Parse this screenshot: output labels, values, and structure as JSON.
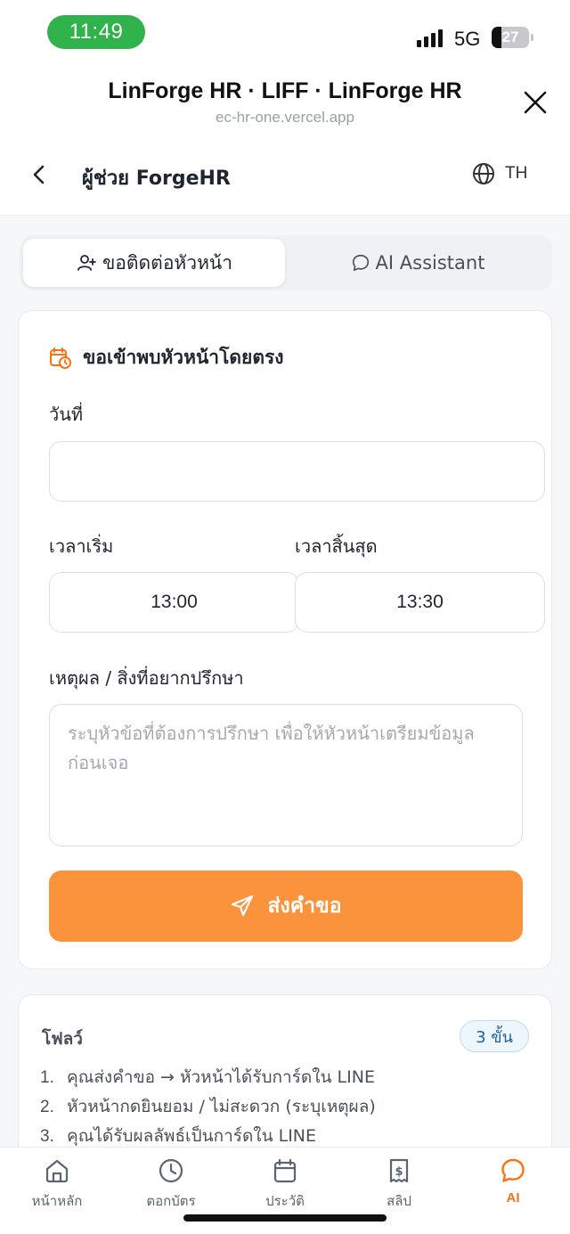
{
  "status_bar": {
    "time": "11:49",
    "network": "5G",
    "battery_percent": "27",
    "battery_level": 0.27,
    "colors": {
      "time_pill": "#2fb34a"
    }
  },
  "liff": {
    "title": "LinForge HR · LIFF · LinForge HR",
    "url": "ec-hr-one.vercel.app",
    "close_icon": "close-icon"
  },
  "app_header": {
    "back_icon": "chevron-left-icon",
    "title": "ผู้ช่วย ForgeHR",
    "language_icon": "globe-icon",
    "language": "TH"
  },
  "tabs": [
    {
      "label": "ขอติดต่อหัวหน้า",
      "icon": "user-plus-icon",
      "active": true
    },
    {
      "label": "AI Assistant",
      "icon": "chat-bubble-icon",
      "active": false
    }
  ],
  "form": {
    "section_icon": "calendar-clock-icon",
    "section_title": "ขอเข้าพบหัวหน้าโดยตรง",
    "date_label": "วันที่",
    "date_value": "",
    "start_label": "เวลาเริ่ม",
    "start_value": "13:00",
    "end_label": "เวลาสิ้นสุด",
    "end_value": "13:30",
    "reason_label": "เหตุผล / สิ่งที่อยากปรึกษา",
    "reason_placeholder": "ระบุหัวข้อที่ต้องการปรึกษา เพื่อให้หัวหน้าเตรียมข้อมูลก่อนเจอ",
    "reason_value": "",
    "submit_label": "ส่งคำขอ",
    "submit_icon": "send-icon",
    "colors": {
      "accent": "#fb923c"
    }
  },
  "flow": {
    "title": "โฟลว์",
    "badge": "3 ขั้น",
    "steps": [
      "คุณส่งคำขอ → หัวหน้าได้รับการ์ดใน LINE",
      "หัวหน้ากดยินยอม / ไม่สะดวก (ระบุเหตุผล)",
      "คุณได้รับผลลัพธ์เป็นการ์ดใน LINE"
    ],
    "step_numbers": [
      "1.",
      "2.",
      "3."
    ]
  },
  "bottom_nav": [
    {
      "label": "หน้าหลัก",
      "icon": "home-icon",
      "active": false
    },
    {
      "label": "ตอกบัตร",
      "icon": "clock-icon",
      "active": false
    },
    {
      "label": "ประวัติ",
      "icon": "calendar-icon",
      "active": false
    },
    {
      "label": "สลิป",
      "icon": "receipt-icon",
      "active": false
    },
    {
      "label": "AI",
      "icon": "chat-bubble-icon",
      "active": true
    }
  ]
}
